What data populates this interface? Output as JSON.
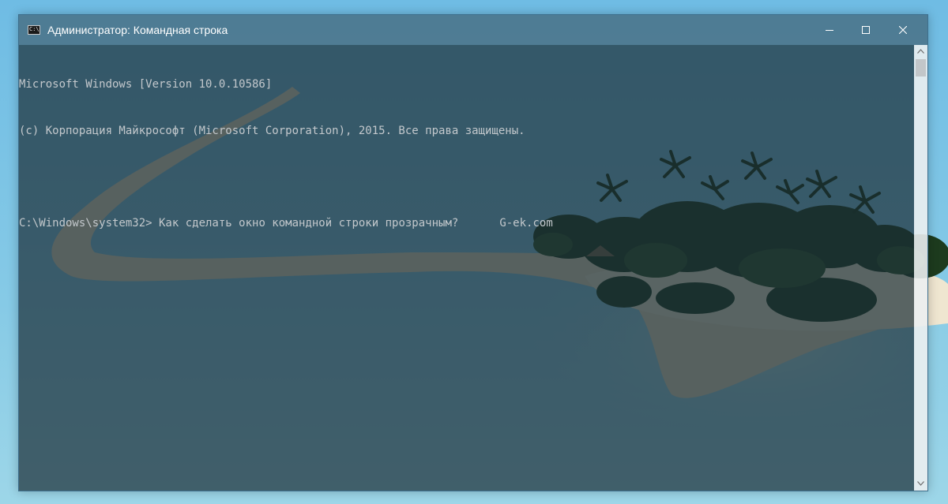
{
  "window": {
    "title": "Администратор: Командная строка",
    "icon": "cmd-icon",
    "icon_text": "C:\\",
    "buttons": [
      "minimize-icon",
      "maximize-icon",
      "close-icon"
    ]
  },
  "console": {
    "line1": "Microsoft Windows [Version 10.0.10586]",
    "line2": "(c) Корпорация Майкрософт (Microsoft Corporation), 2015. Все права защищены.",
    "line3": "",
    "prompt": "C:\\Windows\\system32>",
    "command": " Как сделать окно командной строки прозрачным?",
    "watermark": "G-ek.com"
  },
  "colors": {
    "titlebar": "#466c80",
    "console_bg": "#1a2c34",
    "console_text": "#c3c8cc",
    "sky": "#7cc2e8"
  }
}
